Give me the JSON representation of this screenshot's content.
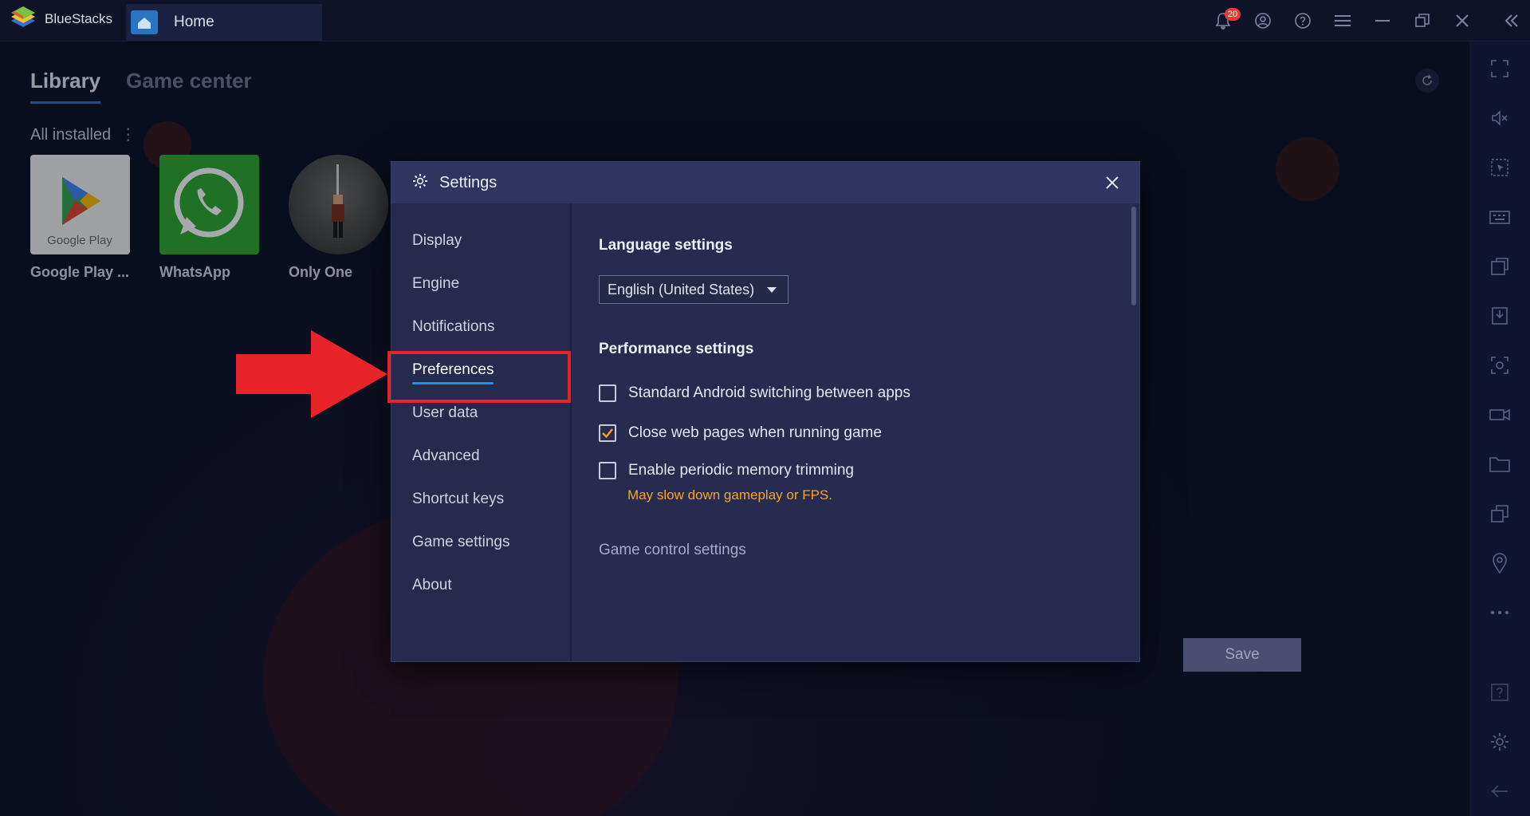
{
  "window": {
    "app_name": "BlueStacks",
    "tab_label": "Home",
    "notification_count": "20"
  },
  "library": {
    "tabs": [
      {
        "label": "Library",
        "active": true
      },
      {
        "label": "Game center",
        "active": false
      }
    ],
    "section_label": "All installed",
    "apps": [
      {
        "name": "Google Play ...",
        "icon": "google-play-icon"
      },
      {
        "name": "WhatsApp",
        "icon": "whatsapp-icon"
      },
      {
        "name": "Only One",
        "icon": "only-one-game-icon"
      }
    ]
  },
  "settings": {
    "title": "Settings",
    "nav": [
      {
        "label": "Display"
      },
      {
        "label": "Engine"
      },
      {
        "label": "Notifications"
      },
      {
        "label": "Preferences",
        "active": true
      },
      {
        "label": "User data"
      },
      {
        "label": "Advanced"
      },
      {
        "label": "Shortcut keys"
      },
      {
        "label": "Game settings"
      },
      {
        "label": "About"
      }
    ],
    "language_heading": "Language settings",
    "language_value": "English (United States)",
    "performance_heading": "Performance settings",
    "options": [
      {
        "label": "Standard Android switching between apps",
        "checked": false
      },
      {
        "label": "Close web pages when running game",
        "checked": true
      },
      {
        "label": "Enable periodic memory trimming",
        "checked": false
      }
    ],
    "memory_warning": "May slow down gameplay or FPS.",
    "game_control_heading": "Game control settings",
    "save_label": "Save"
  },
  "colors": {
    "accent": "#1e8ef0",
    "warning": "#f5a623",
    "annotation": "#e8232a",
    "check": "#f5a623"
  }
}
